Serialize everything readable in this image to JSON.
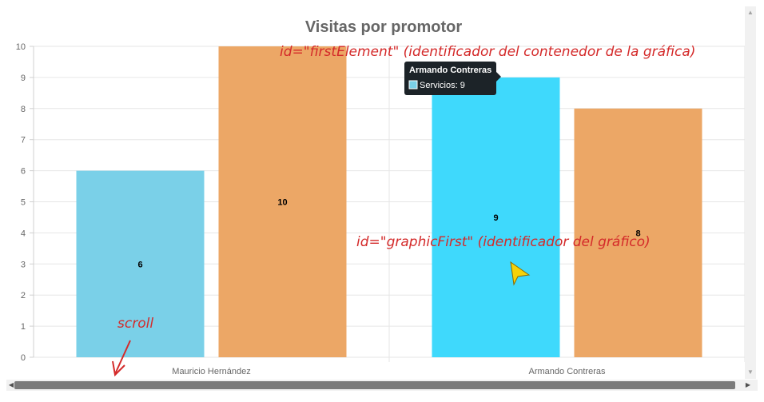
{
  "chart_data": {
    "type": "bar",
    "title": "Visitas por promotor",
    "categories": [
      "Mauricio Hernández",
      "Armando Contreras"
    ],
    "series": [
      {
        "values": [
          6,
          9
        ],
        "color": "#7ad0e8",
        "hover_color": "#3fd9fc"
      },
      {
        "values": [
          10,
          8
        ],
        "color": "#eca766"
      }
    ],
    "ylim": [
      0,
      10
    ],
    "yticks": [
      0,
      1,
      2,
      3,
      4,
      5,
      6,
      7,
      8,
      9,
      10
    ],
    "grid": true,
    "data_labels": true
  },
  "tooltip": {
    "title": "Armando Contreras",
    "body": "Servicios: 9",
    "swatch_color": "#7ad0e8"
  },
  "annotations": {
    "first_element": "id=\"firstElement\" (identificador del contenedor de la gráfica)",
    "graphic_first": "id=\"graphicFirst\" (identificador del gráfico)",
    "scroll": "scroll"
  },
  "scrollbars": {
    "up_arrow": "▲",
    "down_arrow": "▼",
    "left_arrow": "◀",
    "right_arrow": "▶"
  }
}
